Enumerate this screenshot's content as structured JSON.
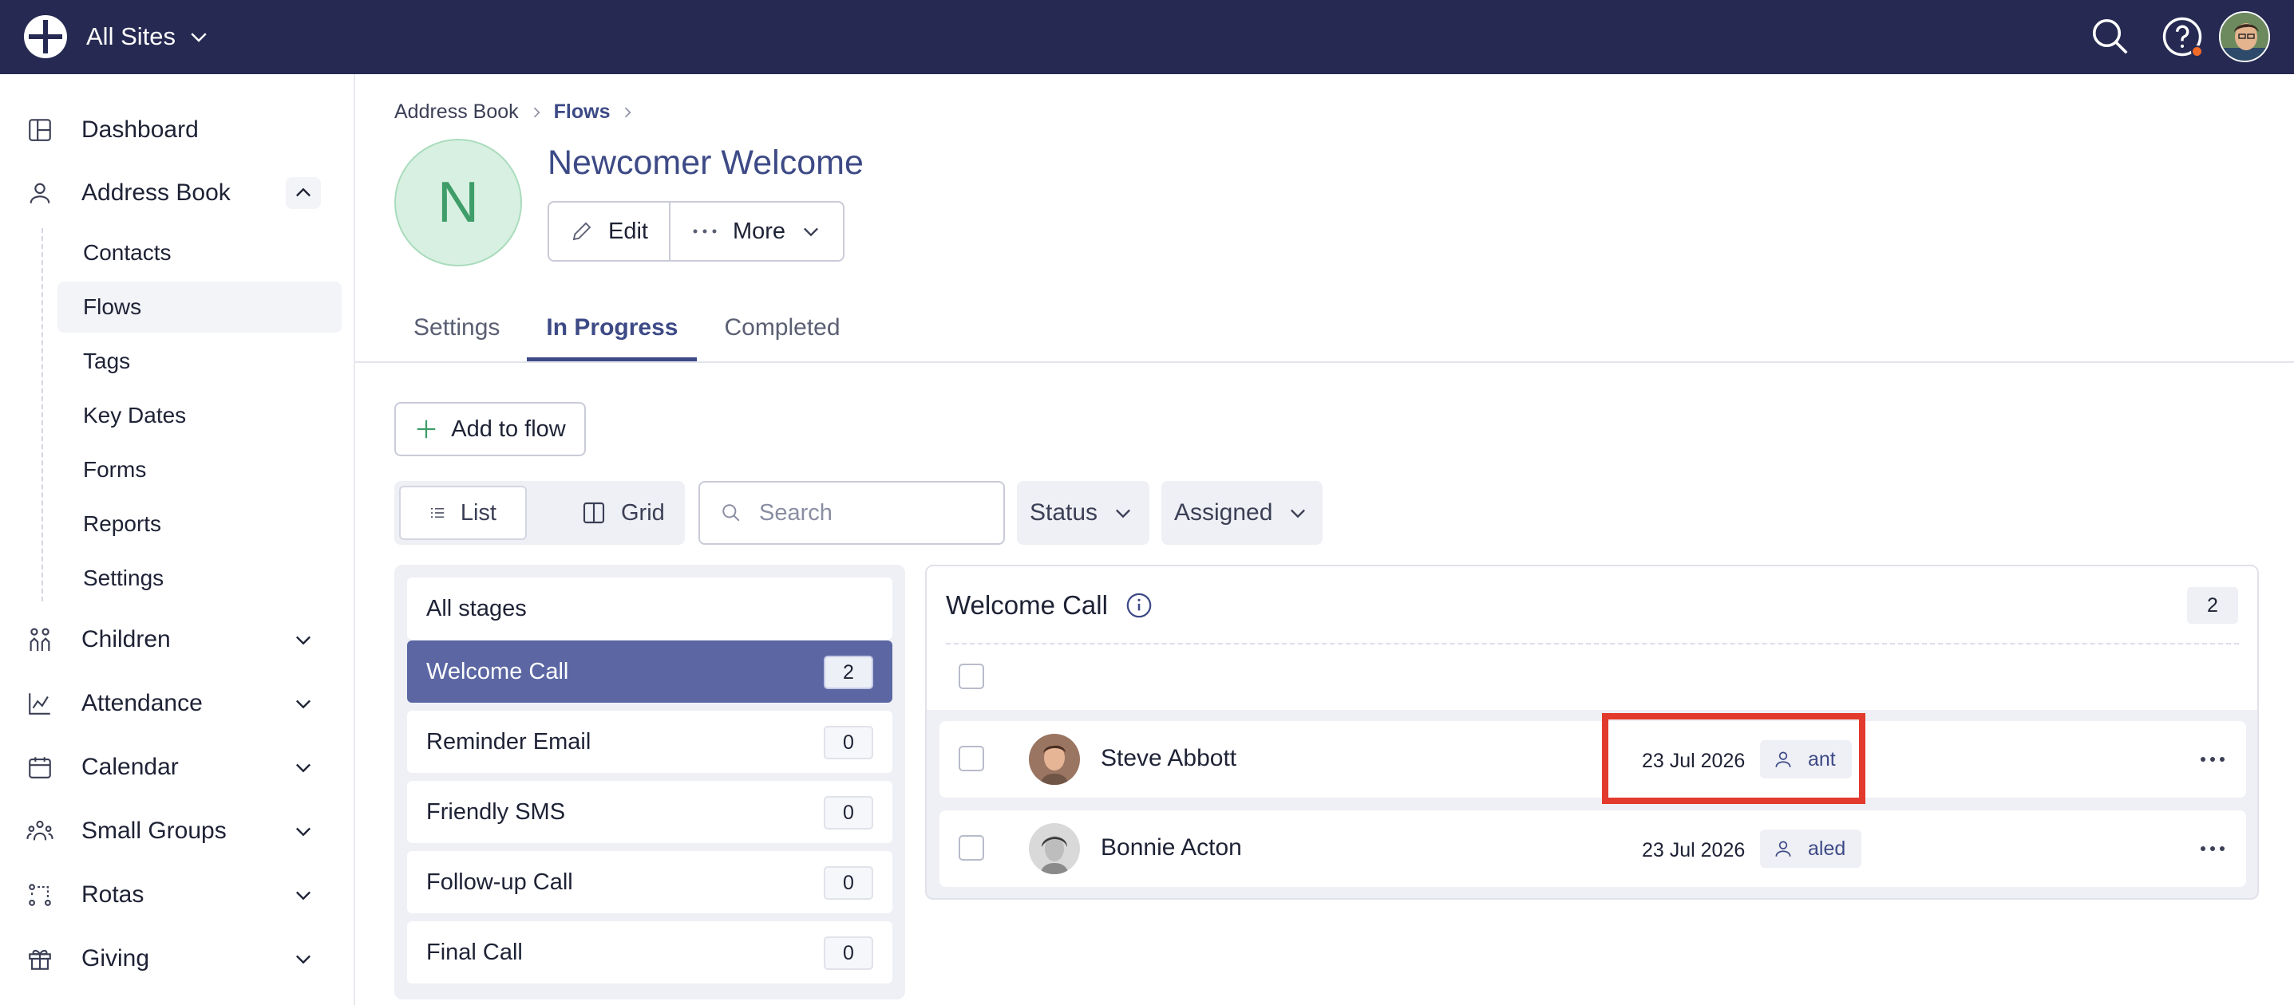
{
  "topbar": {
    "site_label": "All Sites",
    "icons": [
      "logo-icon",
      "search-icon",
      "help-icon",
      "user-avatar"
    ],
    "colors": {
      "background": "#262a52",
      "notification": "#f26b2a"
    }
  },
  "sidebar": {
    "items": [
      {
        "label": "Dashboard",
        "icon": "dashboard-icon"
      },
      {
        "label": "Address Book",
        "icon": "person-icon",
        "expanded": true
      },
      {
        "label": "Children",
        "icon": "children-icon"
      },
      {
        "label": "Attendance",
        "icon": "chart-icon"
      },
      {
        "label": "Calendar",
        "icon": "calendar-icon"
      },
      {
        "label": "Small Groups",
        "icon": "groups-icon"
      },
      {
        "label": "Rotas",
        "icon": "rotas-icon"
      },
      {
        "label": "Giving",
        "icon": "gift-icon"
      }
    ],
    "sub_items": [
      "Contacts",
      "Flows",
      "Tags",
      "Key Dates",
      "Forms",
      "Reports",
      "Settings"
    ],
    "active_sub_item": "Flows"
  },
  "breadcrumb": {
    "parent": "Address Book",
    "current": "Flows"
  },
  "flow": {
    "initial": "N",
    "title": "Newcomer Welcome",
    "edit_label": "Edit",
    "more_label": "More"
  },
  "tabs": [
    "Settings",
    "In Progress",
    "Completed"
  ],
  "active_tab": "In Progress",
  "toolbar": {
    "add_label": "Add to flow",
    "list_label": "List",
    "grid_label": "Grid",
    "search_placeholder": "Search",
    "status_label": "Status",
    "assigned_label": "Assigned"
  },
  "stages": [
    {
      "label": "All stages",
      "count": null
    },
    {
      "label": "Welcome Call",
      "count": "2",
      "active": true
    },
    {
      "label": "Reminder Email",
      "count": "0"
    },
    {
      "label": "Friendly SMS",
      "count": "0"
    },
    {
      "label": "Follow-up Call",
      "count": "0"
    },
    {
      "label": "Final Call",
      "count": "0"
    }
  ],
  "results": {
    "title": "Welcome Call",
    "count": "2",
    "rows": [
      {
        "name": "Steve Abbott",
        "date": "23 Jul 2026",
        "assignee": "ant"
      },
      {
        "name": "Bonnie Acton",
        "date": "23 Jul 2026",
        "assignee": "aled"
      }
    ]
  },
  "colors": {
    "accent": "#3d4a86",
    "active_stage": "#5b66a3",
    "highlight": "#e23a2c",
    "avatar_bg": "#d8f0e1"
  }
}
